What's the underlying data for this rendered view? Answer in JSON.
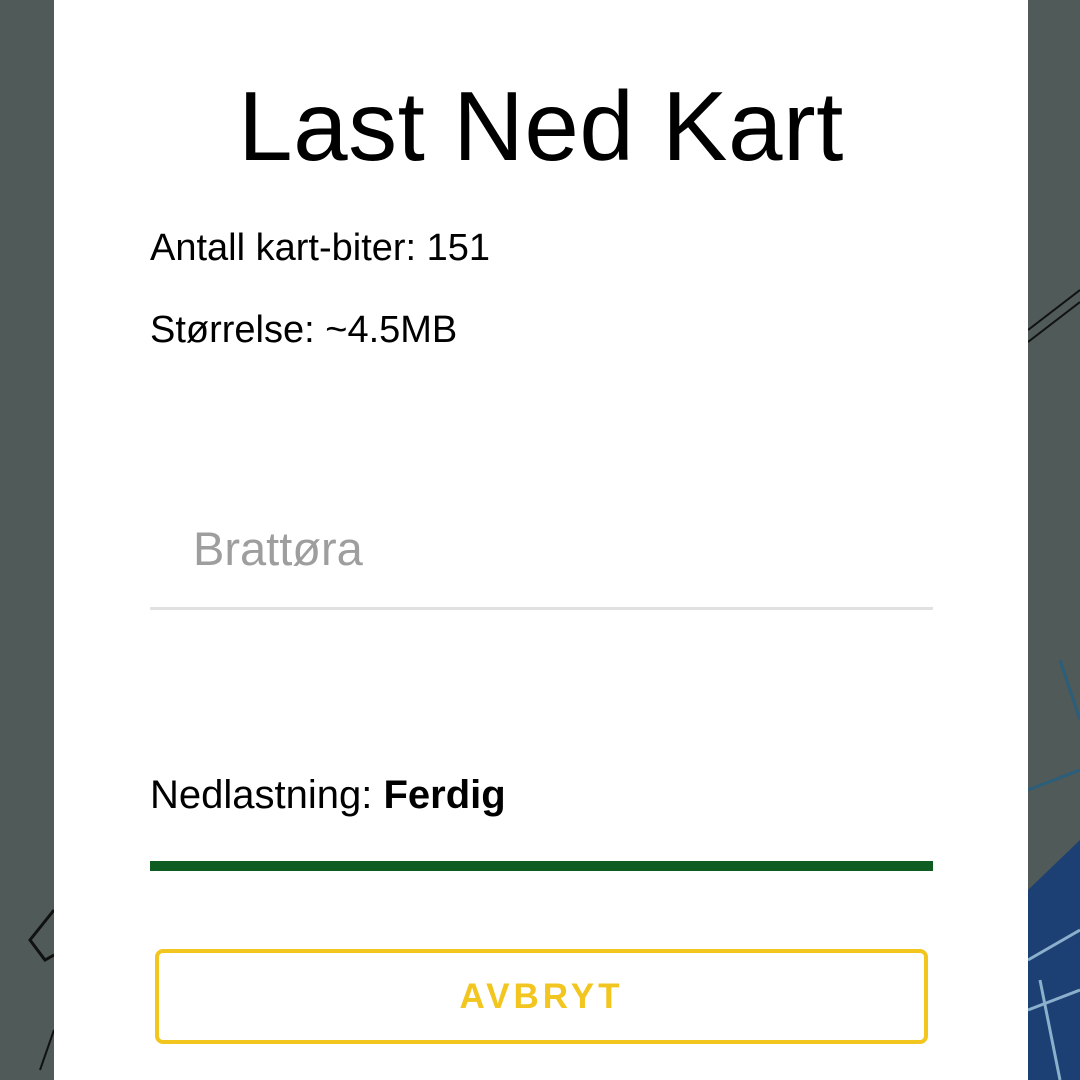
{
  "colors": {
    "map_background": "#4f5a59",
    "map_water": "#1c3f74",
    "dialog_background": "#ffffff",
    "accent_yellow": "#f2c61f",
    "progress_green": "#0e5c22",
    "placeholder_gray": "#9e9e9e"
  },
  "dialog": {
    "title": "Last Ned Kart",
    "tile_count_text": "Antall kart-biter: 151",
    "size_text": "Størrelse: ~4.5MB",
    "name_field": {
      "placeholder": "Brattøra",
      "value": ""
    },
    "download_status": {
      "label": "Nedlastning: ",
      "value": "Ferdig",
      "progress": 1.0
    },
    "cancel_label": "AVBRYT"
  }
}
